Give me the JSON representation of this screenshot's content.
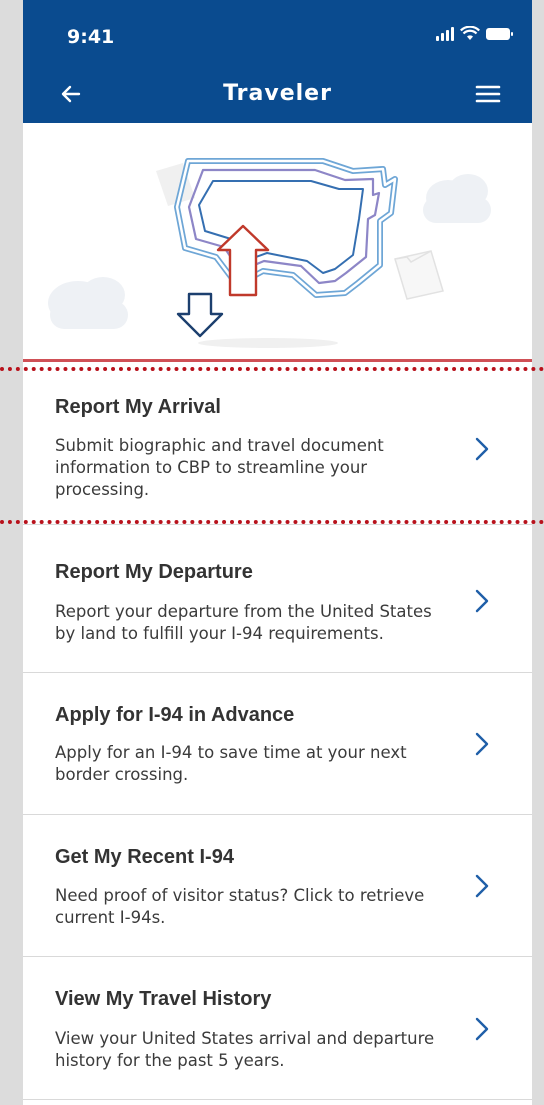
{
  "status": {
    "time": "9:41"
  },
  "nav": {
    "title": "Traveler"
  },
  "menu": [
    {
      "title": "Report My Arrival",
      "desc": "Submit biographic and travel document information to CBP to streamline your processing."
    },
    {
      "title": "Report My Departure",
      "desc": "Report your departure from the United States by land to fulfill your I-94 requirements."
    },
    {
      "title": "Apply for I-94 in Advance",
      "desc": "Apply for an I-94 to save time at your next border crossing."
    },
    {
      "title": "Get My Recent I-94",
      "desc": "Need proof of visitor status? Click to retrieve current I-94s."
    },
    {
      "title": "View My Travel History",
      "desc": "View your United States arrival and departure history for the past 5 years."
    }
  ],
  "colors": {
    "header": "#0a4b8f",
    "accent_red": "#b8121c",
    "chevron": "#1f5fa8"
  },
  "icons": {
    "back": "arrow-left-icon",
    "menu": "hamburger-menu-icon",
    "chevron": "chevron-right-icon"
  }
}
